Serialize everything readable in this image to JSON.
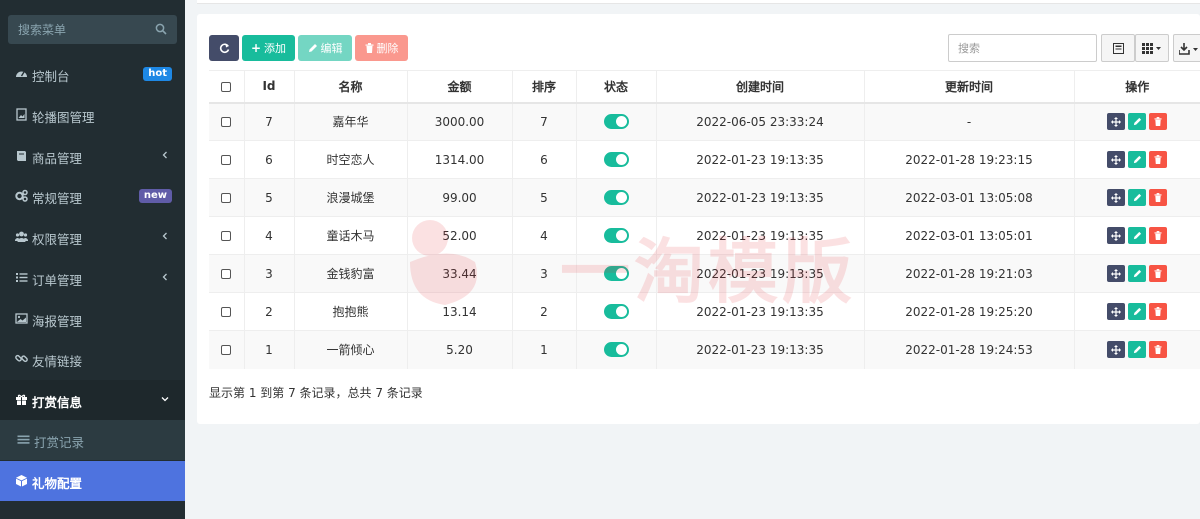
{
  "sidebar": {
    "search_placeholder": "搜索菜单",
    "items": [
      {
        "label": "控制台",
        "badge": "hot"
      },
      {
        "label": "轮播图管理"
      },
      {
        "label": "商品管理"
      },
      {
        "label": "常规管理",
        "badge": "new"
      },
      {
        "label": "权限管理"
      },
      {
        "label": "订单管理"
      },
      {
        "label": "海报管理"
      },
      {
        "label": "友情链接"
      },
      {
        "label": "打赏信息"
      },
      {
        "label": "打赏记录"
      },
      {
        "label": "礼物配置"
      }
    ]
  },
  "toolbar": {
    "add_label": "添加",
    "edit_label": "编辑",
    "delete_label": "删除",
    "search_placeholder": "搜索"
  },
  "table": {
    "columns": [
      "Id",
      "名称",
      "金额",
      "排序",
      "状态",
      "创建时间",
      "更新时间",
      "操作"
    ],
    "rows": [
      {
        "id": "7",
        "name": "嘉年华",
        "amount": "3000.00",
        "sort": "7",
        "status": true,
        "created": "2022-06-05 23:33:24",
        "updated": "-"
      },
      {
        "id": "6",
        "name": "时空恋人",
        "amount": "1314.00",
        "sort": "6",
        "status": true,
        "created": "2022-01-23 19:13:35",
        "updated": "2022-01-28 19:23:15"
      },
      {
        "id": "5",
        "name": "浪漫城堡",
        "amount": "99.00",
        "sort": "5",
        "status": true,
        "created": "2022-01-23 19:13:35",
        "updated": "2022-03-01 13:05:08"
      },
      {
        "id": "4",
        "name": "童话木马",
        "amount": "52.00",
        "sort": "4",
        "status": true,
        "created": "2022-01-23 19:13:35",
        "updated": "2022-03-01 13:05:01"
      },
      {
        "id": "3",
        "name": "金钱豹富",
        "amount": "33.44",
        "sort": "3",
        "status": true,
        "created": "2022-01-23 19:13:35",
        "updated": "2022-01-28 19:21:03"
      },
      {
        "id": "2",
        "name": "抱抱熊",
        "amount": "13.14",
        "sort": "2",
        "status": true,
        "created": "2022-01-23 19:13:35",
        "updated": "2022-01-28 19:25:20"
      },
      {
        "id": "1",
        "name": "一箭倾心",
        "amount": "5.20",
        "sort": "1",
        "status": true,
        "created": "2022-01-23 19:13:35",
        "updated": "2022-01-28 19:24:53"
      }
    ]
  },
  "pagination": {
    "info": "显示第 1 到第 7 条记录，总共 7 条记录"
  },
  "watermark": {
    "text": "一淘模版"
  },
  "colors": {
    "sidebar_bg": "#222d32",
    "primary": "#18bc9c",
    "danger": "#f75444",
    "dark": "#444c69",
    "active_menu": "#4e73df"
  }
}
